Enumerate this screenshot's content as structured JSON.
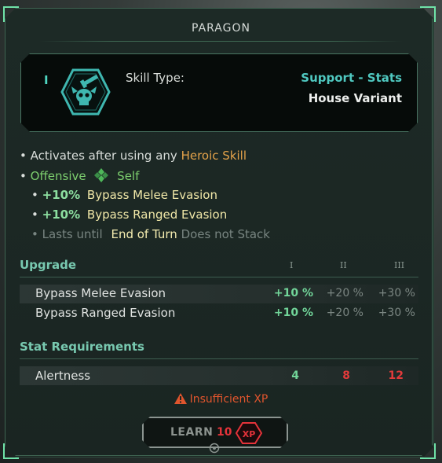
{
  "title": "PARAGON",
  "skill": {
    "tier": "I",
    "type_label": "Skill Type:",
    "type_value": "Support - Stats",
    "variant": "House Variant",
    "icon": "skull-gun-hex-icon"
  },
  "description": {
    "line1_prefix": "• Activates after using any",
    "line1_highlight": "Heroic Skill",
    "line2_bullet": "•",
    "line2_offensive": "Offensive",
    "line2_target_icon": "diamond-target-icon",
    "line2_self": "Self",
    "effects": [
      {
        "bullet": "•",
        "value": "+10%",
        "label": "Bypass Melee Evasion"
      },
      {
        "bullet": "•",
        "value": "+10%",
        "label": "Bypass Ranged Evasion"
      }
    ],
    "duration_bullet": "•",
    "duration_prefix": "Lasts until",
    "duration_value": "End of Turn",
    "duration_suffix": "Does not Stack"
  },
  "upgrade": {
    "header": "Upgrade",
    "columns": [
      "I",
      "II",
      "III"
    ],
    "rows": [
      {
        "label": "Bypass Melee Evasion",
        "values": [
          "+10 %",
          "+20 %",
          "+30 %"
        ]
      },
      {
        "label": "Bypass Ranged Evasion",
        "values": [
          "+10 %",
          "+20 %",
          "+30 %"
        ]
      }
    ]
  },
  "requirements": {
    "header": "Stat Requirements",
    "rows": [
      {
        "label": "Alertness",
        "values": [
          "4",
          "8",
          "12"
        ]
      }
    ]
  },
  "warning": {
    "icon": "warning-triangle-icon",
    "text": "Insufficient XP"
  },
  "learn": {
    "label": "LEARN",
    "cost": "10",
    "currency": "XP"
  },
  "colors": {
    "accent_teal": "#4fc8c0",
    "accent_green": "#72d69a",
    "warning": "#e0552d",
    "cost_red": "#e5333a"
  }
}
